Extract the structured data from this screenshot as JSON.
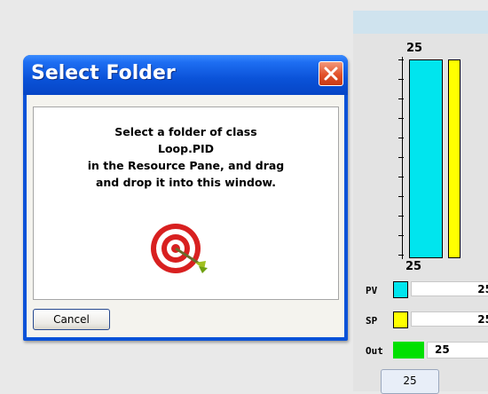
{
  "dialog": {
    "title": "Select Folder",
    "message_lines": [
      "Select a folder of class",
      "Loop.PID",
      "in the Resource Pane, and drag",
      "and drop it into this window."
    ],
    "cancel_label": "Cancel"
  },
  "faceplate": {
    "scale_max": "25",
    "scale_min": "25",
    "pv_label": "PV",
    "pv_value": "25",
    "sp_label": "SP",
    "sp_value": "25",
    "out_label": "Out",
    "out_value": "25",
    "bottom_value": "25",
    "colors": {
      "pv": "#00e5ee",
      "sp": "#ffff00",
      "out": "#00e000"
    }
  },
  "icons": {
    "close": "close-icon",
    "target": "target-dart-icon"
  }
}
